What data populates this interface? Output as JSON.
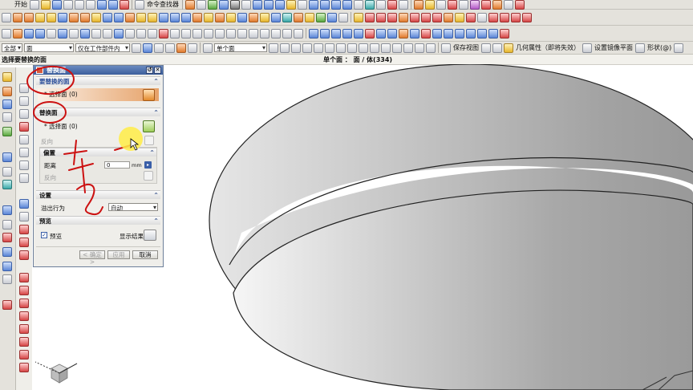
{
  "menu": {
    "start_label": "开始",
    "command_finder": "命令查找器"
  },
  "toolbar3": {
    "filter_all": "全部",
    "filter_face": "面",
    "filter_scope": "仅在工作部件内",
    "filter_single_face": "单个面",
    "save_view": "保存视图",
    "geometry_property": "几何属性（即将失效）",
    "mirror_plane": "设置镜像平面",
    "shape": "形状(@)"
  },
  "status": {
    "prompt": "选择要替换的面",
    "selection_info": "单个面 ： 面 / 体(334)"
  },
  "dialog": {
    "title": "替换面",
    "sec_target": "要替换的面",
    "target_select": "* 选择面 (0)",
    "sec_replacement": "替换面",
    "replacement_select": "* 选择面 (0)",
    "reverse_label": "反向",
    "sec_offset": "偏置",
    "distance_label": "距离",
    "distance_value": "0",
    "distance_unit": "mm",
    "reverse_offset_label": "反向",
    "sec_settings": "设置",
    "overflow_label": "溢出行为",
    "overflow_value": "自动",
    "sec_preview": "预览",
    "preview_label": "预览",
    "show_result": "显示结果",
    "ok": "< 确定 >",
    "apply": "应用",
    "cancel": "取消"
  },
  "colors": {
    "dialog_title": "#4a6ba8",
    "annotation": "#cc1111",
    "model_dark": "#9a9a9a",
    "model_light": "#f0f0f0"
  }
}
